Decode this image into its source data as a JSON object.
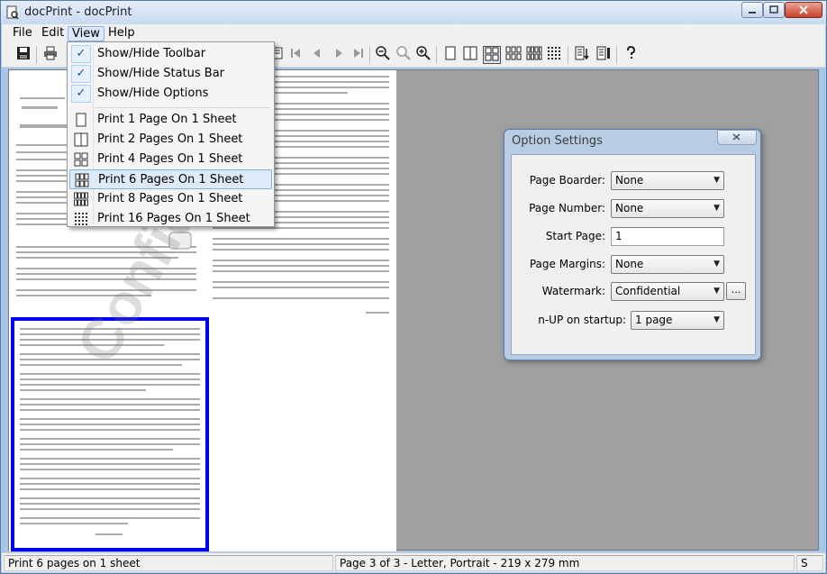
{
  "window": {
    "title": "docPrint - docPrint"
  },
  "menubar": {
    "file": "File",
    "edit": "Edit",
    "view": "View",
    "help": "Help"
  },
  "view_menu": {
    "items": [
      {
        "label": "Show/Hide Toolbar",
        "checked": true,
        "icon": "check-icon"
      },
      {
        "label": "Show/Hide Status Bar",
        "checked": true,
        "icon": "check-icon"
      },
      {
        "label": "Show/Hide Options",
        "checked": true,
        "icon": "check-icon"
      },
      {
        "label": "Print 1 Page On 1 Sheet",
        "checked": false,
        "icon": "layout-1up-icon"
      },
      {
        "label": "Print 2 Pages On 1 Sheet",
        "checked": false,
        "icon": "layout-2up-icon"
      },
      {
        "label": "Print 4 Pages On 1 Sheet",
        "checked": false,
        "icon": "layout-4up-icon"
      },
      {
        "label": "Print 6 Pages On 1 Sheet",
        "checked": false,
        "icon": "layout-6up-icon",
        "highlighted": true
      },
      {
        "label": "Print 8 Pages On 1 Sheet",
        "checked": false,
        "icon": "layout-8up-icon"
      },
      {
        "label": "Print 16 Pages On 1 Sheet",
        "checked": false,
        "icon": "layout-16up-icon"
      }
    ]
  },
  "preview": {
    "watermark_text": "Confidential"
  },
  "dialog": {
    "title": "Option Settings",
    "close_label": "x",
    "page_boarder": {
      "label": "Page Boarder:",
      "value": "None"
    },
    "page_number": {
      "label": "Page Number:",
      "value": "None"
    },
    "start_page": {
      "label": "Start Page:",
      "value": "1"
    },
    "page_margins": {
      "label": "Page Margins:",
      "value": "None"
    },
    "watermark": {
      "label": "Watermark:",
      "value": "Confidential",
      "button": "..."
    },
    "nup": {
      "label": "n-UP on startup:",
      "value": "1 page"
    }
  },
  "statusbar": {
    "left": "Print 6 pages on 1 sheet",
    "middle": "Page 3 of 3 - Letter, Portrait - 219 x 279 mm",
    "right": "S"
  }
}
